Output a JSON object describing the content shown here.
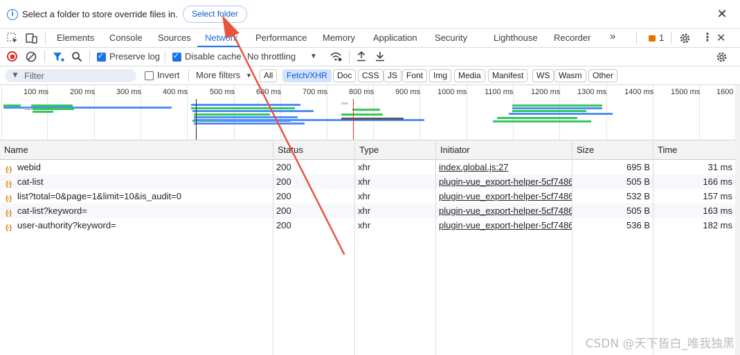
{
  "infobar": {
    "message": "Select a folder to store override files in.",
    "select_button": "Select folder",
    "info_icon": "info-icon",
    "close_icon": "close-icon"
  },
  "tabs": [
    "Elements",
    "Console",
    "Sources",
    "Network",
    "Performance",
    "Memory",
    "Application",
    "Security",
    "Lighthouse",
    "Recorder"
  ],
  "active_tab": "Network",
  "tabbar": {
    "more_tabs": "»",
    "issues_count": "1",
    "settings_icon": "gear-icon",
    "menu_icon": "kebab-menu-icon",
    "close_icon": "close-icon"
  },
  "toolbar": {
    "preserve_log": "Preserve log",
    "disable_cache": "Disable cache",
    "throttling": "No throttling"
  },
  "filterbar": {
    "filter_placeholder": "Filter",
    "invert": "Invert",
    "more_filters": "More filters",
    "chips": [
      "All",
      "Fetch/XHR",
      "Doc",
      "CSS",
      "JS",
      "Font",
      "Img",
      "Media",
      "Manifest",
      "WS",
      "Wasm",
      "Other"
    ],
    "selected_chip": "Fetch/XHR"
  },
  "overview": {
    "ticks": [
      "100 ms",
      "200 ms",
      "300 ms",
      "400 ms",
      "500 ms",
      "600 ms",
      "700 ms",
      "800 ms",
      "900 ms",
      "1000 ms",
      "1100 ms",
      "1200 ms",
      "1300 ms",
      "1400 ms",
      "1500 ms",
      "1600"
    ]
  },
  "table": {
    "columns": [
      "Name",
      "Status",
      "Type",
      "Initiator",
      "Size",
      "Time"
    ],
    "rows": [
      {
        "name": "webid",
        "status": "200",
        "type": "xhr",
        "initiator": "index.global.js:27",
        "size": "695 B",
        "time": "31 ms"
      },
      {
        "name": "cat-list",
        "status": "200",
        "type": "xhr",
        "initiator": "plugin-vue_export-helper-5cf7486",
        "size": "505 B",
        "time": "166 ms"
      },
      {
        "name": "list?total=0&page=1&limit=10&is_audit=0",
        "status": "200",
        "type": "xhr",
        "initiator": "plugin-vue_export-helper-5cf7486",
        "size": "532 B",
        "time": "157 ms"
      },
      {
        "name": "cat-list?keyword=",
        "status": "200",
        "type": "xhr",
        "initiator": "plugin-vue_export-helper-5cf7486",
        "size": "505 B",
        "time": "163 ms"
      },
      {
        "name": "user-authority?keyword=",
        "status": "200",
        "type": "xhr",
        "initiator": "plugin-vue_export-helper-5cf7486",
        "size": "536 B",
        "time": "182 ms"
      }
    ]
  },
  "watermark": "CSDN @天下皆白_唯我独黑",
  "colors": {
    "accent": "#1a73e8",
    "annotation_arrow": "#e8553f",
    "record_red": "#d93025"
  }
}
